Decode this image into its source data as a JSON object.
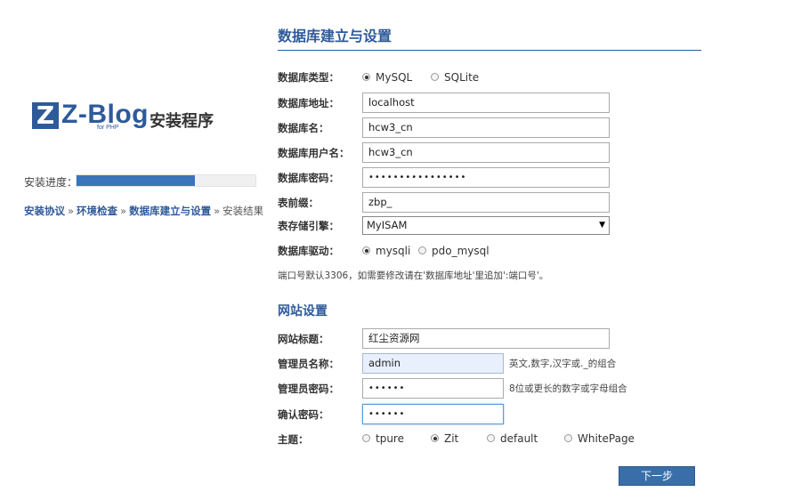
{
  "sidebar": {
    "logo_letter": "Z",
    "logo_text": "Z-Blog",
    "logo_sub": "for PHP",
    "installer_title": "安装程序",
    "progress_label": "安装进度：",
    "progress_fraction": 0.66,
    "steps": [
      {
        "label": "安装协议",
        "done": true
      },
      {
        "label": "环境检查",
        "done": true
      },
      {
        "label": "数据库建立与设置",
        "done": true
      },
      {
        "label": "安装结果",
        "done": false
      }
    ],
    "separator": "»"
  },
  "db": {
    "title": "数据库建立与设置",
    "type_label": "数据库类型：",
    "type_options": [
      "MySQL",
      "SQLite"
    ],
    "type_selected": "MySQL",
    "host_label": "数据库地址：",
    "host_value": "localhost",
    "name_label": "数据库名：",
    "name_value": "hcw3_cn",
    "user_label": "数据库用户名：",
    "user_value": "hcw3_cn",
    "password_label": "数据库密码：",
    "password_value": "••••••••••••••••",
    "prefix_label": "表前缀：",
    "prefix_value": "zbp_",
    "engine_label": "表存储引擎：",
    "engine_value": "MyISAM",
    "driver_label": "数据库驱动：",
    "driver_options": [
      "mysqli",
      "pdo_mysql"
    ],
    "driver_selected": "mysqli",
    "note": "端口号默认3306，如需要修改请在'数据库地址'里追加':端口号'。"
  },
  "site": {
    "title": "网站设置",
    "site_title_label": "网站标题：",
    "site_title_value": "红尘资源网",
    "admin_name_label": "管理员名称：",
    "admin_name_value": "admin",
    "admin_name_hint": "英文,数字,汉字或._的组合",
    "admin_pwd_label": "管理员密码：",
    "admin_pwd_value": "••••••",
    "admin_pwd_hint": "8位或更长的数字或字母组合",
    "confirm_label": "确认密码：",
    "confirm_value": "••••••",
    "theme_label": "主题：",
    "theme_options": [
      "tpure",
      "Zit",
      "default",
      "WhitePage"
    ],
    "theme_selected": "Zit"
  },
  "actions": {
    "next_label": "下一步"
  },
  "colors": {
    "accent": "#2e5a9a",
    "button": "#3a6ea8",
    "progress": "#3a75b9"
  }
}
